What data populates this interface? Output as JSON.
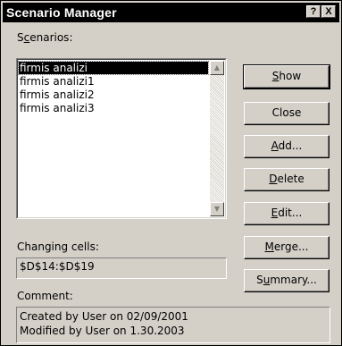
{
  "window": {
    "title": "Scenario Manager",
    "help_button": "?",
    "close_button": "X"
  },
  "scenarios": {
    "label_prefix": "S",
    "label_mnemonic": "c",
    "label_suffix": "enarios:",
    "items": [
      {
        "label": "firmis analizi",
        "selected": true
      },
      {
        "label": "firmis analizi1",
        "selected": false
      },
      {
        "label": "firmis analizi2",
        "selected": false
      },
      {
        "label": "firmis analizi3",
        "selected": false
      }
    ]
  },
  "buttons": {
    "show": {
      "prefix": "",
      "mnemonic": "S",
      "suffix": "how"
    },
    "close": {
      "label": "Close"
    },
    "add": {
      "prefix": "",
      "mnemonic": "A",
      "suffix": "dd..."
    },
    "delete": {
      "prefix": "",
      "mnemonic": "D",
      "suffix": "elete"
    },
    "edit": {
      "prefix": "",
      "mnemonic": "E",
      "suffix": "dit..."
    },
    "merge": {
      "prefix": "",
      "mnemonic": "M",
      "suffix": "erge..."
    },
    "summary": {
      "prefix": "S",
      "mnemonic": "u",
      "suffix": "mmary..."
    }
  },
  "changing_cells": {
    "label": "Changing cells:",
    "value": "$D$14:$D$19"
  },
  "comment": {
    "label": "Comment:",
    "lines": [
      "Created by User on 02/09/2001",
      "Modified by User on 1.30.2003"
    ]
  }
}
